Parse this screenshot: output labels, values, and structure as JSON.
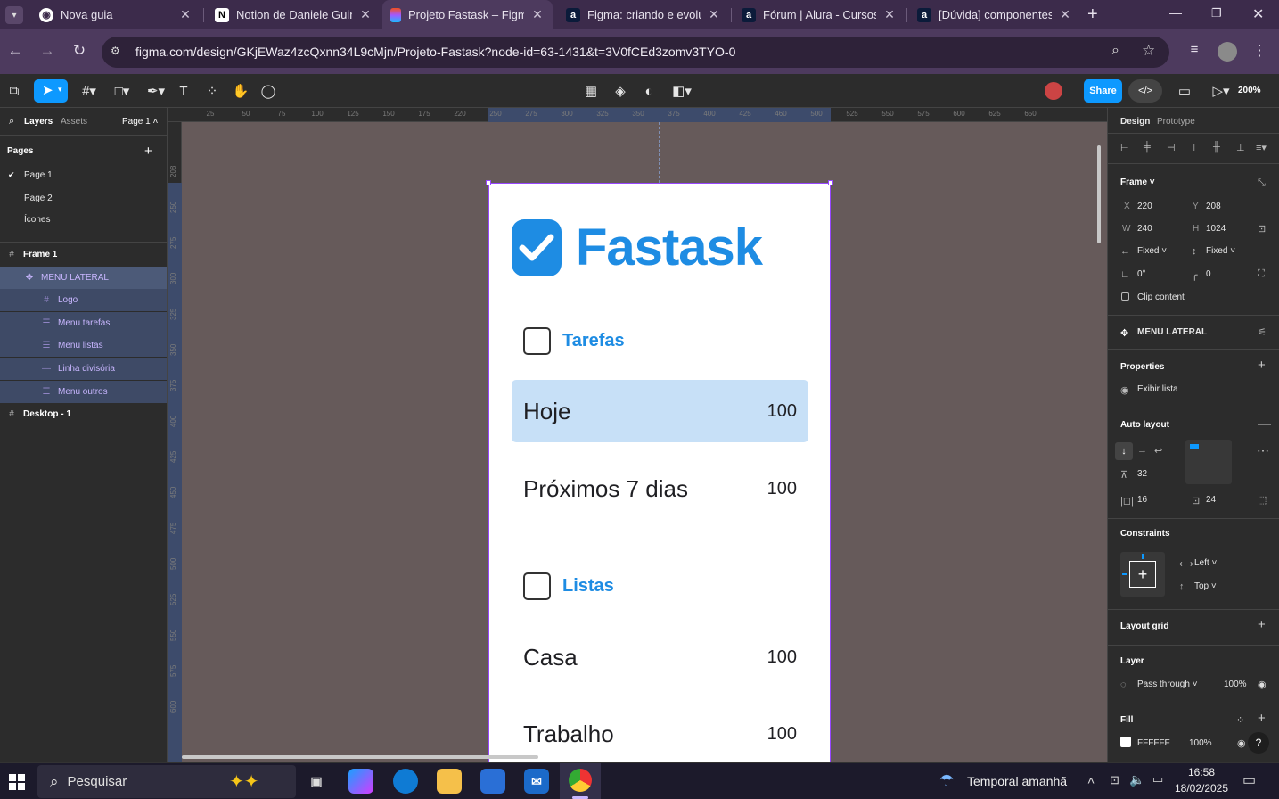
{
  "browser": {
    "tabs": [
      {
        "title": "Nova guia",
        "icon": "chrome-icon"
      },
      {
        "title": "Notion de Daniele Guim",
        "icon": "notion-icon"
      },
      {
        "title": "Projeto Fastask – Figma",
        "icon": "figma-icon",
        "active": true
      },
      {
        "title": "Figma: criando e evoluindo",
        "icon": "alura-icon"
      },
      {
        "title": "Fórum | Alura - Cursos o",
        "icon": "alura-icon"
      },
      {
        "title": "[Dúvida] componentes",
        "icon": "alura-icon"
      }
    ],
    "url": "figma.com/design/GKjEWaz4zcQxnn34L9cMjn/Projeto-Fastask?node-id=63-1431&t=3V0fCEd3zomv3TYO-0"
  },
  "toolbar": {
    "share_label": "Share",
    "dev_label": "</>",
    "zoom": "200%"
  },
  "left_panel": {
    "tabs": {
      "layers": "Layers",
      "assets": "Assets",
      "page_select": "Page 1"
    },
    "pages_heading": "Pages",
    "pages": [
      "Page 1",
      "Page 2",
      "Ícones"
    ],
    "layers": [
      {
        "name": "Frame 1",
        "icon": "frame-icon"
      },
      {
        "name": "MENU LATERAL",
        "icon": "component-icon"
      },
      {
        "name": "Logo",
        "icon": "frame-icon"
      },
      {
        "name": "Menu tarefas",
        "icon": "autolayout-icon"
      },
      {
        "name": "Menu listas",
        "icon": "autolayout-icon"
      },
      {
        "name": "Linha divisória",
        "icon": "line-icon"
      },
      {
        "name": "Menu outros",
        "icon": "autolayout-icon"
      },
      {
        "name": "Desktop - 1",
        "icon": "frame-icon"
      }
    ]
  },
  "rulers": {
    "top": [
      "25",
      "50",
      "75",
      "100",
      "125",
      "150",
      "175",
      "220",
      "250",
      "275",
      "300",
      "325",
      "350",
      "375",
      "400",
      "425",
      "460",
      "500",
      "525",
      "550",
      "575",
      "600",
      "625",
      "650"
    ],
    "left": [
      "208",
      "250",
      "275",
      "300",
      "325",
      "350",
      "375",
      "400",
      "425",
      "450",
      "475",
      "500",
      "525",
      "550",
      "575",
      "600"
    ]
  },
  "canvas": {
    "logo_text": "Fastask",
    "section_tarefas": "Tarefas",
    "section_listas": "Listas",
    "menu_items": [
      {
        "label": "Hoje",
        "count": "100",
        "selected": true
      },
      {
        "label": "Próximos 7 dias",
        "count": "100"
      },
      {
        "label": "Casa",
        "count": "100"
      },
      {
        "label": "Trabalho",
        "count": "100"
      }
    ]
  },
  "right_panel": {
    "tabs": {
      "design": "Design",
      "prototype": "Prototype"
    },
    "frame": {
      "heading": "Frame",
      "x_label": "X",
      "x": "220",
      "y_label": "Y",
      "y": "208",
      "w_label": "W",
      "w": "240",
      "h_label": "H",
      "h": "1024",
      "h_sizing": "Fixed",
      "v_sizing": "Fixed",
      "rotation": "0°",
      "radius": "0",
      "clip_content": "Clip content"
    },
    "component_name": "MENU LATERAL",
    "properties": {
      "heading": "Properties",
      "item": "Exibir lista"
    },
    "auto_layout": {
      "heading": "Auto layout",
      "gap": "32",
      "padding_h": "16",
      "padding_v": "24"
    },
    "constraints": {
      "heading": "Constraints",
      "horizontal": "Left",
      "vertical": "Top"
    },
    "layout_grid": "Layout grid",
    "layer": {
      "heading": "Layer",
      "blend": "Pass through",
      "opacity": "100%"
    },
    "fill": {
      "heading": "Fill",
      "hex": "FFFFFF",
      "opacity": "100%"
    }
  },
  "taskbar": {
    "search_placeholder": "Pesquisar",
    "weather": "Temporal amanhã",
    "time": "16:58",
    "date": "18/02/2025"
  },
  "colors": {
    "accent": "#0d99ff",
    "brand": "#1e8ce3",
    "canvas_bg": "#665a5a",
    "selected_row": "#c7e0f7"
  }
}
